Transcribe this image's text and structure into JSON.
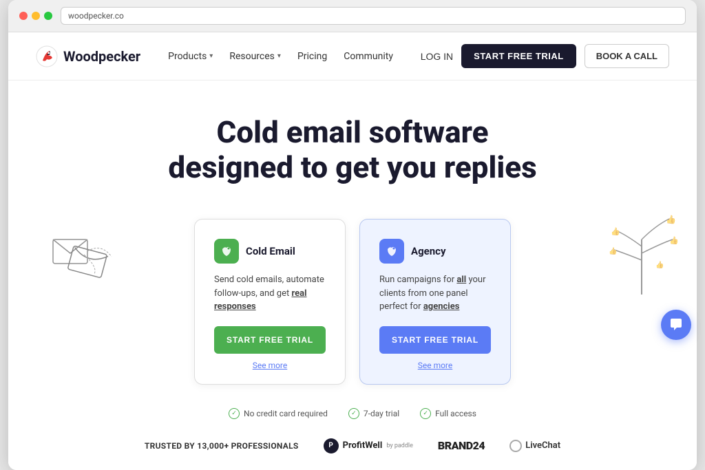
{
  "browser": {
    "address": "woodpecker.co"
  },
  "navbar": {
    "logo_text": "Woodpecker",
    "products_label": "Products",
    "resources_label": "Resources",
    "pricing_label": "Pricing",
    "community_label": "Community",
    "login_label": "LOG IN",
    "trial_label": "START FREE TRIAL",
    "book_label": "BOOK A CALL"
  },
  "hero": {
    "title_line1": "Cold email software",
    "title_line2": "designed to get you replies"
  },
  "cards": [
    {
      "id": "cold-email",
      "title": "Cold Email",
      "description_plain": "Send cold emails, automate follow-ups, and get ",
      "description_bold": "real responses",
      "trial_label": "START FREE TRIAL",
      "see_more": "See more",
      "icon_type": "green"
    },
    {
      "id": "agency",
      "title": "Agency",
      "description_plain": "Run campaigns for ",
      "description_bold1": "all",
      "description_mid": " your clients from one panel perfect for ",
      "description_bold2": "agencies",
      "trial_label": "START FREE TRIAL",
      "see_more": "See more",
      "icon_type": "blue"
    }
  ],
  "trust": {
    "badges": [
      {
        "text": "No credit card required"
      },
      {
        "text": "7-day trial"
      },
      {
        "text": "Full access"
      }
    ]
  },
  "bottom": {
    "trusted_text": "TRUSTED BY 13,000+ PROFESSIONALS",
    "brands": [
      "ProfitWell",
      "BRAND24",
      "LiveChat"
    ]
  }
}
